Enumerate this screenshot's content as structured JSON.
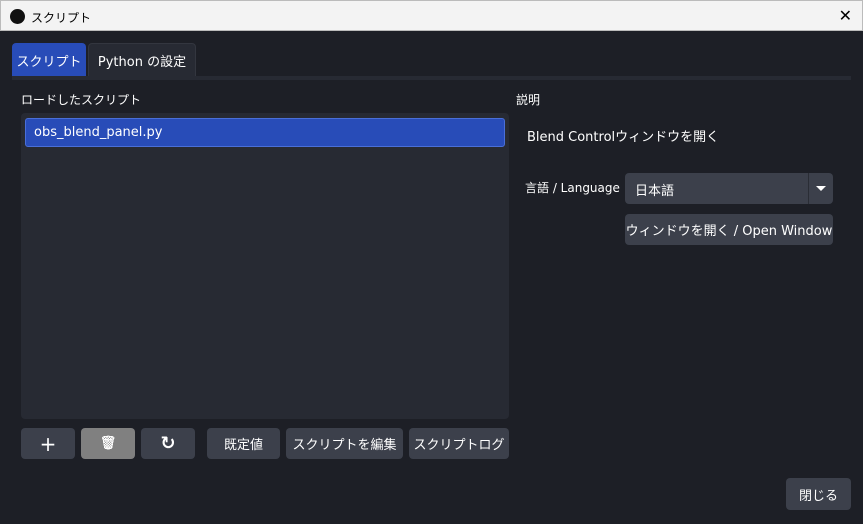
{
  "window": {
    "title": "スクリプト",
    "close": "✕"
  },
  "tabs": [
    {
      "label": "スクリプト"
    },
    {
      "label": "Python の設定"
    }
  ],
  "left": {
    "label": "ロードしたスクリプト",
    "scripts": [
      "obs_blend_panel.py"
    ],
    "buttons": {
      "add": "+",
      "remove": "🗑",
      "reload": "↻",
      "defaults": "既定値",
      "edit": "スクリプトを編集",
      "log": "スクリプトログ"
    }
  },
  "right": {
    "label": "説明",
    "description": "Blend Controlウィンドウを開く",
    "language_label": "言語 / Language",
    "language_value": "日本語",
    "open_button": "ウィンドウを開く / Open Window"
  },
  "footer": {
    "close": "閉じる"
  },
  "colors": {
    "accent": "#284cb8",
    "bg": "#1d1f26",
    "panel": "#272a33",
    "button": "#3c404b"
  }
}
